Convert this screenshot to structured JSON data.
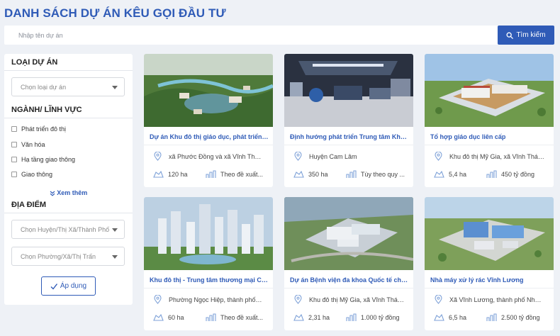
{
  "page": {
    "title": "DANH SÁCH DỰ ÁN KÊU GỌI ĐẦU TƯ"
  },
  "search": {
    "placeholder": "Nhập tên dự án",
    "button_label": "Tìm kiếm"
  },
  "filters": {
    "project_type": {
      "heading": "LOẠI DỰ ÁN",
      "select_placeholder": "Chọn loại dự án"
    },
    "sector": {
      "heading": "NGÀNH/ LĨNH VỰC",
      "options": [
        "Phát triển đô thị",
        "Văn hóa",
        "Hạ tầng giao thông",
        "Giao thông"
      ],
      "see_more": "Xem thêm"
    },
    "location": {
      "heading": "ĐỊA ĐIỂM",
      "district_placeholder": "Chọn Huyện/Thị Xã/Thành Phố",
      "ward_placeholder": "Chọn Phường/Xã/Thị Trấn"
    },
    "apply_label": "Áp dụng"
  },
  "projects": [
    {
      "title": "Dự án Khu đô thị giáo dục, phát triển côn...",
      "location": "xã Phước Đồng và xã Vĩnh Thái,...",
      "area": "120 ha",
      "investment": "Theo đề xuất..."
    },
    {
      "title": "Định hướng phát triển Trung tâm Khoa họ...",
      "location": "Huyện Cam Lâm",
      "area": "350 ha",
      "investment": "Tùy theo quy ..."
    },
    {
      "title": "Tổ hợp giáo dục liên cấp",
      "location": "Khu đô thị Mỹ Gia, xã Vĩnh Thái,...",
      "area": "5,4 ha",
      "investment": "450 tỷ đồng"
    },
    {
      "title": "Khu đô thị - Trung tâm thương mại Côn...",
      "location": "Phường Ngọc Hiệp, thành phố Nh...",
      "area": "60 ha",
      "investment": "Theo đề xuất..."
    },
    {
      "title": "Dự án Bệnh viện đa khoa Quốc tế chất...",
      "location": "Khu đô thị Mỹ Gia, xã Vĩnh Thái,...",
      "area": "2,31 ha",
      "investment": "1.000 tỷ đồng"
    },
    {
      "title": "Nhà máy xử lý rác Vĩnh Lương",
      "location": "Xã Vĩnh Lương, thành phố Nha,...",
      "area": "6,5 ha",
      "investment": "2.500 tỷ đồng"
    }
  ],
  "icons": {
    "search": "search-icon",
    "dropdown": "chevron-down-icon",
    "location": "map-pin-icon",
    "area": "land-area-icon",
    "investment": "investment-icon",
    "apply": "check-icon"
  },
  "colors": {
    "primary": "#2f5bb7",
    "background": "#eef1f6",
    "icon_tint": "#7fa2d8"
  }
}
